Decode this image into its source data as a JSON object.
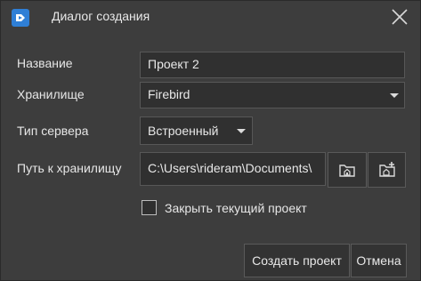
{
  "window": {
    "title": "Диалог создания"
  },
  "form": {
    "name_label": "Название",
    "name_value": "Проект 2",
    "storage_label": "Хранилище",
    "storage_value": "Firebird",
    "server_type_label": "Тип сервера",
    "server_type_value": "Встроенный",
    "path_label": "Путь к хранилищу",
    "path_value": "C:\\Users\\rideram\\Documents\\",
    "close_current_label": "Закрыть текущий проект",
    "close_current_checked": false
  },
  "buttons": {
    "create": "Создать проект",
    "cancel": "Отмена"
  },
  "icons": {
    "app": "app-logo-icon",
    "close": "close-icon",
    "browse_folder": "folder-home-icon",
    "new_folder": "folder-new-icon"
  },
  "colors": {
    "background": "#3d3d3d",
    "field": "#303030",
    "border": "#575757",
    "accent": "#2f7fd6"
  }
}
